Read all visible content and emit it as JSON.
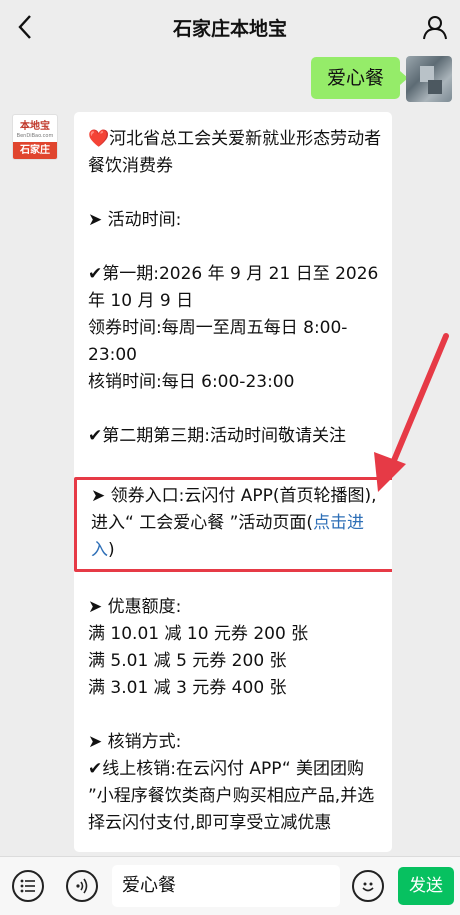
{
  "header": {
    "title": "石家庄本地宝",
    "back_icon": "chevron-left-icon",
    "profile_icon": "person-icon"
  },
  "outgoing": {
    "text": "爱心餐"
  },
  "bot_avatar": {
    "top_text": "本地宝",
    "url_text": "BenDiBao.com",
    "bottom_text": "石家庄"
  },
  "message": {
    "title": "❤️河北省总工会关爱新就业形态劳动者餐饮消费券",
    "activity_heading": "➤ 活动时间:",
    "phase1_date": "✔第一期:2026 年 9 月 21 日至 2026 年 10 月 9 日",
    "phase1_claim": "领券时间:每周一至周五每日 8:00-23:00",
    "phase1_redeem": "核销时间:每日 6:00-23:00",
    "phase23": "✔第二期第三期:活动时间敬请关注",
    "entry_text": "➤ 领券入口:云闪付 APP(首页轮播图),进入“ 工会爱心餐 ”活动页面(",
    "entry_link": "点击进入",
    "entry_end": ")",
    "discount_heading": "➤ 优惠额度:",
    "discounts": [
      "满 10.01 减 10 元券 200 张",
      "满 5.01 减 5 元券 200 张",
      "满 3.01 减 3 元券 400 张"
    ],
    "redeem_heading": "➤ 核销方式:",
    "redeem_online": "✔线上核销:在云闪付 APP“ 美团团购 ”小程序餐饮类商户购买相应产品,并选择云闪付支付,即可享受立减优惠"
  },
  "input_bar": {
    "menu_icon": "menu-list-icon",
    "voice_icon": "voice-icon",
    "text": "爱心餐",
    "emoji_icon": "emoji-icon",
    "send_label": "发送"
  },
  "colors": {
    "send": "#07c160",
    "bubble_out": "#95ec69",
    "highlight": "#e63a46",
    "link": "#2e6fb7"
  }
}
